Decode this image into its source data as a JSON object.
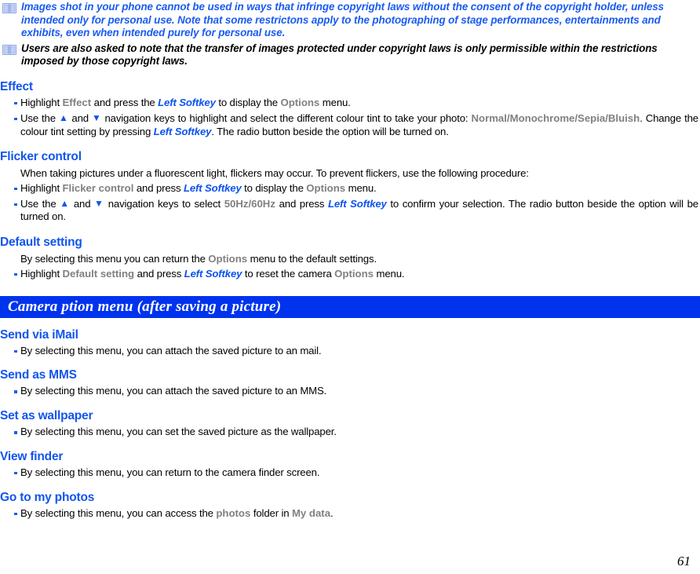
{
  "notes": [
    {
      "icon": "book-icon",
      "style": "blue",
      "text": "Images shot in your phone cannot be used in ways that infringe copyright laws without the consent of the copyright holder, unless intended only for personal use. Note that some restrictons apply to the photographing of stage performances, entertainments and exhibits, even when intended purely for personal use."
    },
    {
      "icon": "book-icon",
      "style": "black",
      "text": "Users are also asked to note that the transfer of images protected under copyright laws is only permissible within the restrictions imposed by those copyright laws."
    }
  ],
  "sections": {
    "effect": {
      "heading": "Effect",
      "bullet1": {
        "p1": "Highlight ",
        "term1": "Effect",
        "p2": " and press the ",
        "softkey": "Left Softkey",
        "p3": " to display the ",
        "term2": "Options",
        "p4": " menu."
      },
      "bullet2": {
        "p1": "Use the ",
        "up": "▲",
        "p2": " and ",
        "down": "▼",
        "p3": " navigation keys to highlight and select the different colour tint to take your photo: ",
        "term1": "Normal/Monochrome/Sepia/Bluish",
        "p4": ". Change the colour tint setting by pressing ",
        "softkey": "Left Softkey",
        "p5": ". The radio button beside the option will be turned on."
      }
    },
    "flicker": {
      "heading": "Flicker control",
      "intro": "When taking pictures under a fluorescent light, flickers may occur. To prevent flickers, use the following procedure:",
      "bullet1": {
        "p1": "Highlight ",
        "term1": "Flicker control",
        "p2": " and press ",
        "softkey": "Left Softkey",
        "p3": " to display the ",
        "term2": "Options",
        "p4": " menu."
      },
      "bullet2": {
        "p1": "Use the ",
        "up": "▲",
        "p2": " and ",
        "down": "▼",
        "p3": " navigation keys to select ",
        "term1": "50Hz/60Hz",
        "p4": " and press ",
        "softkey": "Left Softkey",
        "p5": " to confirm your selection. The radio button beside the option will be turned on."
      }
    },
    "default_setting": {
      "heading": "Default setting",
      "intro_p1": "By selecting this menu you can return the ",
      "intro_term": "Options",
      "intro_p2": " menu to the default settings.",
      "bullet1": {
        "p1": "Highlight ",
        "term1": "Default setting",
        "p2": " and press ",
        "softkey": "Left Softkey",
        "p3": " to reset the camera ",
        "term2": "Options",
        "p4": " menu."
      }
    },
    "imail": {
      "heading": "Send via iMail",
      "bullet1": "By selecting this menu, you can attach the saved picture to an mail."
    },
    "mms": {
      "heading": "Send as MMS",
      "bullet1": "By selecting this menu, you can attach the saved picture to an MMS."
    },
    "wallpaper": {
      "heading": "Set as wallpaper",
      "bullet1": "By selecting this menu, you can set the saved picture as the wallpaper."
    },
    "viewfinder": {
      "heading": "View finder",
      "bullet1": "By selecting this menu, you can return to the camera finder screen."
    },
    "photos": {
      "heading": "Go to my photos",
      "bullet1": {
        "p1": "By selecting this menu, you can access the ",
        "term1": "photos",
        "p2": " folder in ",
        "term2": "My data",
        "p3": "."
      }
    }
  },
  "banner": {
    "title": "Camera ption menu (after saving a picture)"
  },
  "footer": {
    "page_number": "61"
  },
  "colors": {
    "heading_blue": "#1155ee",
    "banner_blue": "#0033ee",
    "note_blue": "#1a5cf0",
    "ui_term_gray": "#808080",
    "softkey_blue": "#0a52f0",
    "bullet_blue": "#1a5cf0",
    "book_icon_blue": "#8fa7e8"
  }
}
